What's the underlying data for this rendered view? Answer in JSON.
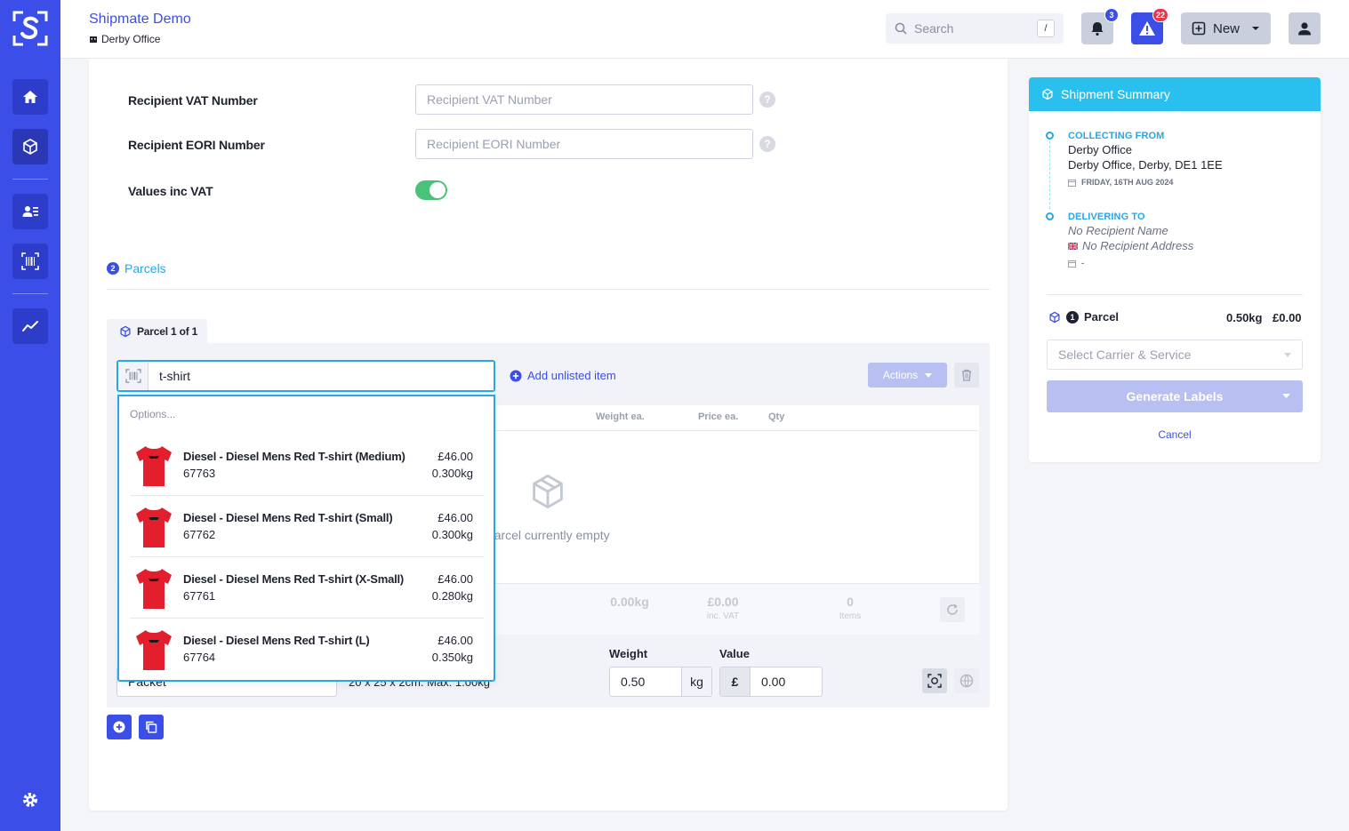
{
  "app": {
    "title": "Shipmate Demo",
    "location": "Derby Office"
  },
  "search": {
    "placeholder": "Search",
    "shortcut": "/"
  },
  "notifications": {
    "count": "3"
  },
  "alerts": {
    "count": "22"
  },
  "new_button": {
    "label": "New"
  },
  "colors": {
    "brand": "#3b4ee8",
    "accent": "#29a6e8",
    "toggle_on": "#4ac27a",
    "alert_badge": "#e8344e"
  },
  "sidebar": {
    "items": [
      {
        "name": "home",
        "icon": "home-icon"
      },
      {
        "name": "shipments",
        "icon": "package-icon"
      },
      {
        "name": "contacts",
        "icon": "address-book-icon"
      },
      {
        "name": "scan",
        "icon": "barcode-scan-icon"
      },
      {
        "name": "reports",
        "icon": "chart-line-icon"
      },
      {
        "name": "settings",
        "icon": "gear-icon"
      }
    ]
  },
  "form": {
    "vat": {
      "label": "Recipient VAT Number",
      "placeholder": "Recipient VAT Number"
    },
    "eori": {
      "label": "Recipient EORI Number",
      "placeholder": "Recipient EORI Number"
    },
    "values_inc_vat": {
      "label": "Values inc VAT",
      "on": true
    },
    "help_glyph": "?"
  },
  "parcels": {
    "section_number": "2",
    "section_title": "Parcels",
    "tab_label": "Parcel 1 of 1",
    "scan_value": "t-shirt",
    "add_unlisted": "Add unlisted item",
    "actions_label": "Actions",
    "columns": [
      "Weight ea.",
      "Price ea.",
      "Qty"
    ],
    "empty_text": "Parcel currently empty",
    "totals": {
      "weight": "0.00kg",
      "value": "£0.00",
      "value_sub": "inc. VAT",
      "items": "0",
      "items_sub": "Items"
    },
    "package_type": "Packet",
    "package_dims": "20 x 25 x 2cm. Max: 1.00kg",
    "weight_label": "Weight",
    "weight_value": "0.50",
    "weight_unit": "kg",
    "value_label": "Value",
    "currency": "£",
    "value_amount": "0.00"
  },
  "dropdown": {
    "header": "Options...",
    "options": [
      {
        "name": "Diesel - Diesel Mens Red T-shirt (Medium)",
        "sku": "67763",
        "price": "£46.00",
        "weight": "0.300kg"
      },
      {
        "name": "Diesel - Diesel Mens Red T-shirt (Small)",
        "sku": "67762",
        "price": "£46.00",
        "weight": "0.300kg"
      },
      {
        "name": "Diesel - Diesel Mens Red T-shirt (X-Small)",
        "sku": "67761",
        "price": "£46.00",
        "weight": "0.280kg"
      },
      {
        "name": "Diesel - Diesel Mens Red T-shirt (L)",
        "sku": "67764",
        "price": "£46.00",
        "weight": "0.350kg"
      }
    ]
  },
  "summary": {
    "title": "Shipment Summary",
    "collecting_label": "COLLECTING FROM",
    "collecting_name": "Derby Office",
    "collecting_address": "Derby Office, Derby, DE1 1EE",
    "collecting_date": "FRIDAY, 16TH AUG 2024",
    "delivering_label": "DELIVERING TO",
    "delivering_name": "No Recipient Name",
    "delivering_address": "No Recipient Address",
    "delivering_date": "-",
    "parcel_number": "1",
    "parcel_label": "Parcel",
    "parcel_weight": "0.50kg",
    "parcel_price": "£0.00",
    "carrier_placeholder": "Select Carrier & Service",
    "generate_label": "Generate Labels",
    "cancel_label": "Cancel"
  }
}
